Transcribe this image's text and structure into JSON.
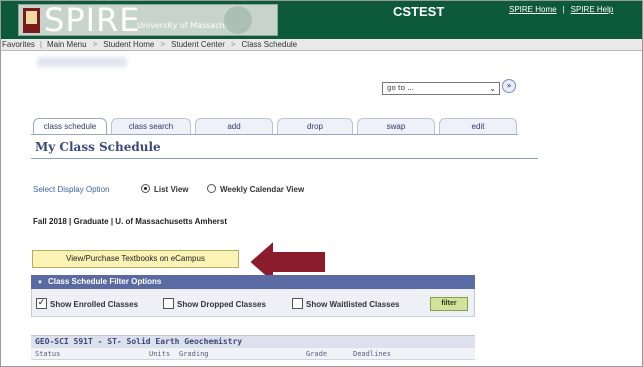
{
  "header": {
    "logo_text": "SPIRE",
    "logo_subtext": "University of Massachusetts",
    "app_name": "CSTEST",
    "links": [
      "SPIRE Home",
      "SPIRE Help"
    ],
    "link_separator": "|"
  },
  "nav": {
    "items": [
      "Favorites",
      "Main Menu"
    ],
    "breadcrumb": [
      "Student Home",
      "Student Center",
      "Class Schedule"
    ],
    "separator": ">"
  },
  "goto": {
    "value": "go to ...",
    "button_glyph": "»"
  },
  "tabs": [
    "class schedule",
    "class search",
    "add",
    "drop",
    "swap",
    "edit"
  ],
  "active_tab": "class schedule",
  "page_title": "My Class Schedule",
  "display": {
    "label": "Select Display Option",
    "options": [
      "List View",
      "Weekly Calendar View"
    ],
    "selected": "List View"
  },
  "term_line": "Fall 2018 | Graduate | U. of Massachusetts Amherst",
  "textbooks_button": "View/Purchase Textbooks on eCampus",
  "filter": {
    "title": "Class Schedule Filter Options",
    "options": [
      {
        "label": "Show Enrolled Classes",
        "checked": true
      },
      {
        "label": "Show Dropped Classes",
        "checked": false
      },
      {
        "label": "Show Waitlisted Classes",
        "checked": false
      }
    ],
    "button": "filter"
  },
  "course": {
    "title": "GEO-SCI 591T - ST- Solid Earth Geochemistry",
    "columns": [
      "Status",
      "Units",
      "Grading",
      "Grade",
      "Deadlines"
    ]
  },
  "colors": {
    "header_green": "#0d5a3a",
    "accent_blue": "#3a4a7c",
    "filter_header": "#5a6aa2",
    "textbook_button": "#fbf2b5",
    "arrow": "#8a1c2b"
  }
}
